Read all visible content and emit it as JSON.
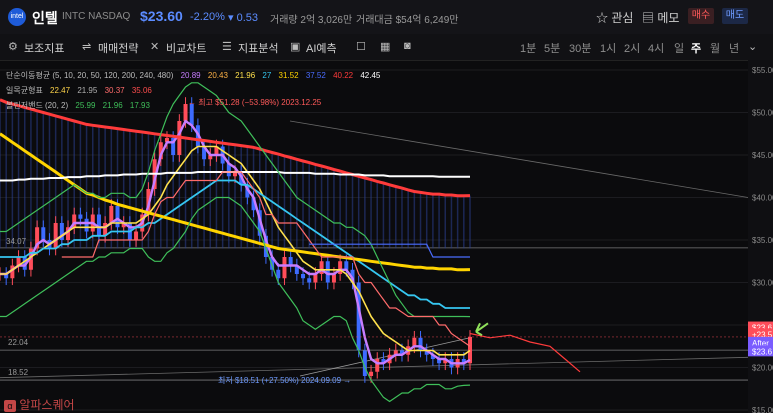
{
  "header": {
    "logo": "intel",
    "name": "인텔",
    "ticker": "INTC  NASDAQ",
    "price": "$23.60",
    "change_pct": "-2.20%",
    "change": "▾ 0.53",
    "volume": "거래량 2억 3,026만",
    "amount": "거래대금 $54억 6,249만",
    "watch": "☆ 관심",
    "memo": "▤ 메모",
    "buy": "매수",
    "sell": "매도"
  },
  "toolbar": {
    "items": [
      "보조지표",
      "매매전략",
      "비교차트",
      "지표분석",
      "AI예측"
    ],
    "timeframes": [
      "1분",
      "5분",
      "30분",
      "1시",
      "2시",
      "4시",
      "일",
      "주",
      "월",
      "년"
    ],
    "active_timeframe": "주"
  },
  "legend": {
    "sma_label": "단순이동평균 (5, 10, 20, 50, 120, 200, 240, 480)",
    "sma_values": [
      "20.89",
      "20.43",
      "21.96",
      "27",
      "31.52",
      "37.52",
      "40.22",
      "42.45"
    ],
    "sma_colors": [
      "#c77dff",
      "#ffb347",
      "#ffe14d",
      "#36c6f0",
      "#ffd400",
      "#4a6cff",
      "#ff3b3b",
      "#ffffff"
    ],
    "ichimoku_label": "일목균형표",
    "ichimoku_values": [
      "22.47",
      "21.95",
      "30.37",
      "35.06"
    ],
    "ichimoku_colors": [
      "#ffd54a",
      "#b0b0b0",
      "#ff6b6b",
      "#ff4d4d"
    ],
    "bb_label": "볼린저밴드 (20, 2)",
    "bb_values": [
      "25.99",
      "21.96",
      "17.93"
    ],
    "bb_colors": [
      "#3fbf5a",
      "#3fbf5a",
      "#3fbf5a"
    ]
  },
  "annotations": {
    "high": "← 최고 $51.28 (−53.98%)  2023.12.25",
    "low": "최저 $18.51 (+27.50%)  2024.09.09 →",
    "h_level": "34.07",
    "mid_level": "22.04",
    "low_level": "18.52",
    "watermark": "알파스퀘어"
  },
  "chart_data": {
    "type": "line",
    "y_axis": {
      "ticks": [
        "$55.00",
        "$50.00",
        "$45.00",
        "$40.00",
        "$35.00",
        "$30.00",
        "$25.00",
        "$20.00",
        "$15.00"
      ],
      "range": [
        15,
        55
      ]
    },
    "price_tags": [
      "$23.6",
      "+23.5",
      "After",
      "$23.6"
    ],
    "price_close": [
      31,
      30.5,
      32,
      33,
      31.5,
      34,
      36.5,
      35,
      34,
      37,
      35,
      36.5,
      38,
      37.5,
      36,
      38,
      35.5,
      37,
      39,
      36.5,
      37,
      35,
      36,
      38,
      41,
      44.5,
      46.5,
      47,
      45,
      49,
      51,
      48.5,
      46,
      44.5,
      45,
      46,
      44,
      42.5,
      43,
      41.5,
      40,
      38.5,
      35.5,
      33,
      31.5,
      30.5,
      33,
      32,
      31,
      30.5,
      30,
      31,
      32.5,
      30,
      31,
      32.5,
      31.5,
      30,
      22,
      19,
      19.5,
      21,
      20.5,
      21.5,
      22,
      21.5,
      22.5,
      23.5,
      22,
      21.5,
      21,
      20.5,
      21,
      20,
      21,
      20.5,
      23.6
    ],
    "series": [
      {
        "name": "5",
        "color": "#c77dff",
        "values": [
          31,
          31,
          31.5,
          32,
          32,
          33,
          34.5,
          35,
          34.5,
          35,
          35.5,
          36,
          37,
          37,
          37,
          37,
          36.5,
          36.5,
          37,
          37.5,
          37,
          36.5,
          36.5,
          37,
          39,
          42,
          45,
          46.5,
          46.5,
          47.5,
          49,
          48.5,
          47.5,
          46,
          45,
          45,
          45,
          44,
          43.5,
          42.5,
          41,
          40,
          37.5,
          35,
          33,
          32,
          32,
          32,
          32,
          31.5,
          31,
          31,
          31.5,
          31,
          31,
          31.5,
          31.5,
          30.5,
          27,
          23.5,
          21,
          20.5,
          20.5,
          21,
          21.5,
          21.5,
          22,
          22.5,
          22.5,
          22,
          21.5,
          21,
          21,
          20.5,
          20.5,
          20.5,
          20.9
        ]
      },
      {
        "name": "20",
        "color": "#ffe14d",
        "values": [
          31,
          31,
          31.5,
          32,
          32.5,
          33,
          33.5,
          34,
          34.5,
          35,
          35.5,
          36,
          36.5,
          36.5,
          36.5,
          36.5,
          36.5,
          36.5,
          37,
          37,
          37,
          37,
          37,
          37.5,
          38,
          39,
          40,
          41.5,
          42.5,
          43.5,
          44.5,
          45.5,
          46,
          46,
          46,
          46,
          45.5,
          45,
          44.5,
          44,
          43,
          42,
          41,
          39.5,
          38,
          36.5,
          35.5,
          34.5,
          33.5,
          32.5,
          32,
          31.5,
          31.5,
          31.5,
          31.5,
          31.5,
          31,
          30,
          29,
          27.5,
          26,
          25,
          24,
          23.5,
          23,
          22.5,
          22,
          22,
          22,
          22,
          22,
          21.5,
          21.5,
          21.5,
          21.5,
          21.5,
          22
        ]
      },
      {
        "name": "50",
        "color": "#36c6f0",
        "values": [
          33,
          33,
          33,
          33,
          33,
          33.5,
          33.5,
          34,
          34,
          34,
          34.5,
          34.5,
          35,
          35,
          35,
          35.5,
          35.5,
          35.5,
          36,
          36,
          36,
          36,
          36.5,
          36.5,
          37,
          37,
          37.5,
          38,
          38.5,
          39,
          39.5,
          40,
          40.5,
          41,
          41.5,
          42,
          42,
          42,
          42,
          41.5,
          41.5,
          41,
          40.5,
          40,
          39.5,
          39,
          38.5,
          38,
          37.5,
          37,
          36.5,
          36,
          35.5,
          35,
          34.5,
          34,
          33.5,
          33,
          32.5,
          32,
          31.5,
          31,
          30.5,
          30,
          29.5,
          29,
          28.5,
          28.5,
          28,
          28,
          27.5,
          27.5,
          27,
          27,
          27,
          27,
          27
        ]
      },
      {
        "name": "120",
        "color": "#ffd400",
        "values": [
          47.5,
          47,
          46.5,
          46,
          45.5,
          45,
          44.5,
          44,
          43.5,
          43,
          42.5,
          42,
          41.5,
          41,
          40.5,
          40.3,
          40,
          39.7,
          39.5,
          39.2,
          39,
          38.8,
          38.6,
          38.4,
          38.2,
          38,
          37.8,
          37.6,
          37.4,
          37.2,
          37,
          36.8,
          36.6,
          36.4,
          36.2,
          36,
          35.8,
          35.6,
          35.4,
          35.2,
          35,
          34.8,
          34.6,
          34.4,
          34.2,
          34,
          33.9,
          33.8,
          33.7,
          33.6,
          33.5,
          33.4,
          33.3,
          33.2,
          33.1,
          33,
          32.9,
          32.8,
          32.7,
          32.6,
          32.5,
          32.4,
          32.3,
          32.2,
          32.1,
          32,
          31.9,
          31.8,
          31.8,
          31.7,
          31.7,
          31.6,
          31.6,
          31.6,
          31.5,
          31.5,
          31.52
        ]
      },
      {
        "name": "240",
        "color": "#ff3b3b",
        "values": [
          51.5,
          51.2,
          51,
          50.8,
          50.6,
          50.4,
          50.2,
          50,
          49.8,
          49.6,
          49.4,
          49.2,
          49,
          48.8,
          48.6,
          48.5,
          48.4,
          48.3,
          48.2,
          48.1,
          48,
          47.9,
          47.8,
          47.7,
          47.6,
          47.5,
          47.4,
          47.3,
          47.2,
          47.1,
          47,
          46.9,
          46.8,
          46.7,
          46.6,
          46.5,
          46.4,
          46.3,
          46.2,
          46.1,
          46,
          45.9,
          45.7,
          45.5,
          45.3,
          45.1,
          44.9,
          44.7,
          44.5,
          44.3,
          44.1,
          43.9,
          43.7,
          43.5,
          43.3,
          43.1,
          42.9,
          42.7,
          42.5,
          42.3,
          42.1,
          41.9,
          41.7,
          41.5,
          41.3,
          41.1,
          40.9,
          40.7,
          40.6,
          40.5,
          40.4,
          40.4,
          40.3,
          40.3,
          40.2,
          40.2,
          40.22
        ]
      },
      {
        "name": "480",
        "color": "#ffffff",
        "values": [
          42,
          42,
          42,
          42.1,
          42.1,
          42.2,
          42.2,
          42.2,
          42.3,
          42.3,
          42.3,
          42.4,
          42.4,
          42.4,
          42.5,
          42.5,
          42.5,
          42.6,
          42.6,
          42.6,
          42.7,
          42.7,
          42.7,
          42.8,
          42.8,
          42.8,
          42.8,
          42.9,
          42.9,
          42.9,
          42.9,
          42.9,
          43,
          43,
          43,
          43,
          43,
          43,
          43,
          43,
          43,
          43,
          43,
          43,
          43,
          43,
          42.9,
          42.9,
          42.9,
          42.9,
          42.9,
          42.8,
          42.8,
          42.8,
          42.8,
          42.7,
          42.7,
          42.7,
          42.7,
          42.6,
          42.6,
          42.6,
          42.6,
          42.5,
          42.5,
          42.5,
          42.5,
          42.5,
          42.5,
          42.5,
          42.5,
          42.45,
          42.45,
          42.45,
          42.45,
          42.45,
          42.45
        ]
      },
      {
        "name": "bb_upper",
        "color": "#3fbf5a",
        "values": [
          36,
          36,
          36.5,
          37,
          37.5,
          38,
          38.5,
          39,
          39.5,
          40,
          40.5,
          41,
          41.5,
          41,
          40.5,
          40.5,
          40,
          40,
          40.5,
          40.5,
          40.5,
          40,
          40,
          41,
          43,
          45.5,
          47.5,
          49.5,
          51,
          52,
          53,
          53.5,
          53.5,
          53,
          52.5,
          52,
          51,
          50,
          49.5,
          49,
          48,
          47,
          46,
          45,
          44,
          43,
          42,
          41,
          40,
          39.5,
          39,
          38.5,
          38,
          37.5,
          37,
          37,
          36.5,
          36.5,
          36,
          35.5,
          34.5,
          33,
          31.5,
          30,
          28.5,
          27.5,
          26.5,
          26,
          26,
          26,
          26,
          26,
          26,
          26,
          26,
          26,
          25.99
        ]
      },
      {
        "name": "bb_lower",
        "color": "#3fbf5a",
        "values": [
          26,
          26,
          26.5,
          27,
          27.5,
          28,
          28.5,
          29,
          29.5,
          30,
          30.5,
          31,
          31.5,
          32,
          32.5,
          32.5,
          33,
          33,
          33.5,
          33.5,
          33.5,
          34,
          34,
          34,
          33,
          32.5,
          32.5,
          33.5,
          34,
          35,
          36,
          37.5,
          38.5,
          39,
          39.5,
          40,
          40,
          40,
          39.5,
          39,
          38,
          37,
          36,
          34,
          32,
          30,
          29,
          28,
          27,
          25.5,
          25,
          24.5,
          25,
          25.5,
          26,
          26,
          25.5,
          23.5,
          22,
          20,
          18.5,
          17.5,
          16.5,
          16,
          16.5,
          17,
          17,
          17.5,
          17.5,
          18,
          18,
          18,
          17.5,
          17.5,
          17.8,
          17.9,
          17.93
        ]
      },
      {
        "name": "kijun",
        "color": "#ff6b6b",
        "values": [
          null,
          null,
          null,
          null,
          null,
          null,
          null,
          null,
          null,
          null,
          33,
          33,
          33,
          33,
          33,
          33,
          35,
          35,
          35,
          35,
          35,
          35,
          35,
          35,
          36,
          38,
          39.5,
          40,
          40,
          41,
          42,
          42,
          42,
          42,
          42,
          42,
          43,
          43,
          43,
          43,
          42,
          41,
          40,
          38,
          38,
          37,
          37,
          37,
          37,
          36,
          35,
          34,
          33,
          33,
          33,
          33,
          33,
          33,
          31,
          30,
          30,
          29,
          28,
          27,
          27,
          26.5,
          26,
          26,
          26,
          26,
          26,
          25,
          25,
          24,
          23.5,
          23,
          22.5
        ]
      },
      {
        "name": "span_a",
        "color": "#4a6cff",
        "values": [
          null,
          null,
          null,
          null,
          null,
          null,
          null,
          null,
          null,
          null,
          null,
          null,
          null,
          null,
          null,
          null,
          null,
          null,
          null,
          null,
          null,
          null,
          null,
          null,
          null,
          null,
          null,
          null,
          null,
          null,
          null,
          null,
          null,
          null,
          null,
          null,
          null,
          null,
          null,
          null,
          null,
          null,
          null,
          null,
          null,
          null,
          null,
          null,
          null,
          null,
          34.5,
          34.5,
          34.5,
          34.5,
          34.5,
          34.5,
          34.5,
          34.5,
          34.5,
          34.5,
          34.5,
          34.5,
          34.5,
          34.5,
          34.5,
          34.5,
          34.5,
          34.5,
          34.5,
          34.5,
          33,
          33,
          33,
          33,
          33,
          33,
          33
        ]
      }
    ]
  }
}
